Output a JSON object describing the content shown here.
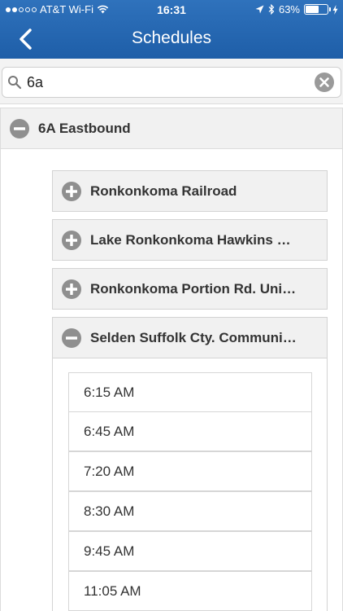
{
  "status_bar": {
    "carrier": "AT&T Wi-Fi",
    "time": "16:31",
    "battery_pct": "63%",
    "battery_level": 0.63,
    "signal_bars_filled": 2,
    "signal_bars_total": 5
  },
  "nav": {
    "title": "Schedules",
    "back_icon": "chevron-left-icon"
  },
  "search": {
    "value": "6a",
    "search_icon": "magnifier-icon",
    "clear_icon": "clear-circle-icon"
  },
  "route": {
    "label": "6A Eastbound",
    "expanded": true,
    "stops": [
      {
        "label": "Ronkonkoma Railroad",
        "expanded": false
      },
      {
        "label": "Lake Ronkonkoma Hawkins …",
        "expanded": false
      },
      {
        "label": "Ronkonkoma Portion Rd. Uni…",
        "expanded": false
      },
      {
        "label": "Selden Suffolk Cty. Communi…",
        "expanded": true
      }
    ],
    "times": [
      "6:15 AM",
      "6:45 AM",
      "7:20 AM",
      "8:30 AM",
      "9:45 AM",
      "11:05 AM"
    ]
  },
  "colors": {
    "nav_bar": "#2566b0",
    "header_bg": "#f1f1f1",
    "icon_gray": "#8f8f8f"
  }
}
